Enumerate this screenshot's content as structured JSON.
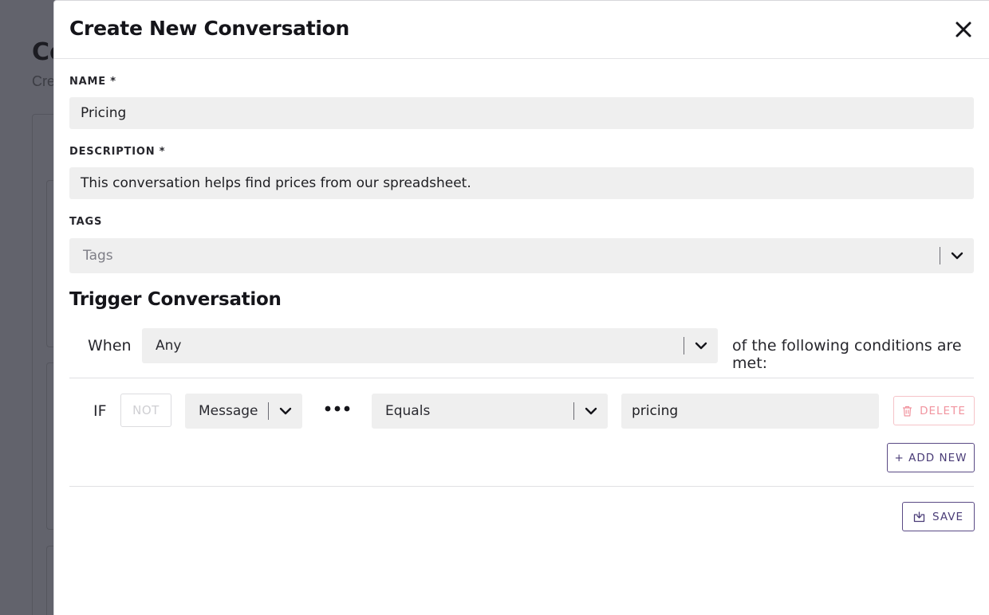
{
  "background": {
    "title": "Co",
    "subtitle": "Cre"
  },
  "modal": {
    "title": "Create New Conversation",
    "close_icon": "close-icon"
  },
  "form": {
    "name": {
      "label": "NAME *",
      "value": "Pricing"
    },
    "description": {
      "label": "DESCRIPTION *",
      "value": "This conversation helps find prices from our spreadsheet."
    },
    "tags": {
      "label": "TAGS",
      "placeholder": "Tags"
    }
  },
  "trigger": {
    "title": "Trigger Conversation",
    "when_label": "When",
    "match_select": "Any",
    "conditions_suffix": "of the following conditions are met:",
    "condition": {
      "if_label": "IF",
      "not_label": "NOT",
      "field_select": "Message",
      "more_icon": "more-horizontal-icon",
      "operator_select": "Equals",
      "value": "pricing",
      "delete_label": "DELETE"
    },
    "add_new_label": "+ ADD NEW"
  },
  "actions": {
    "save_label": "SAVE"
  },
  "colors": {
    "overlay": "#62636c",
    "input_bg": "#efefef",
    "accent": "#4a3c77",
    "danger": "#f1949f"
  }
}
